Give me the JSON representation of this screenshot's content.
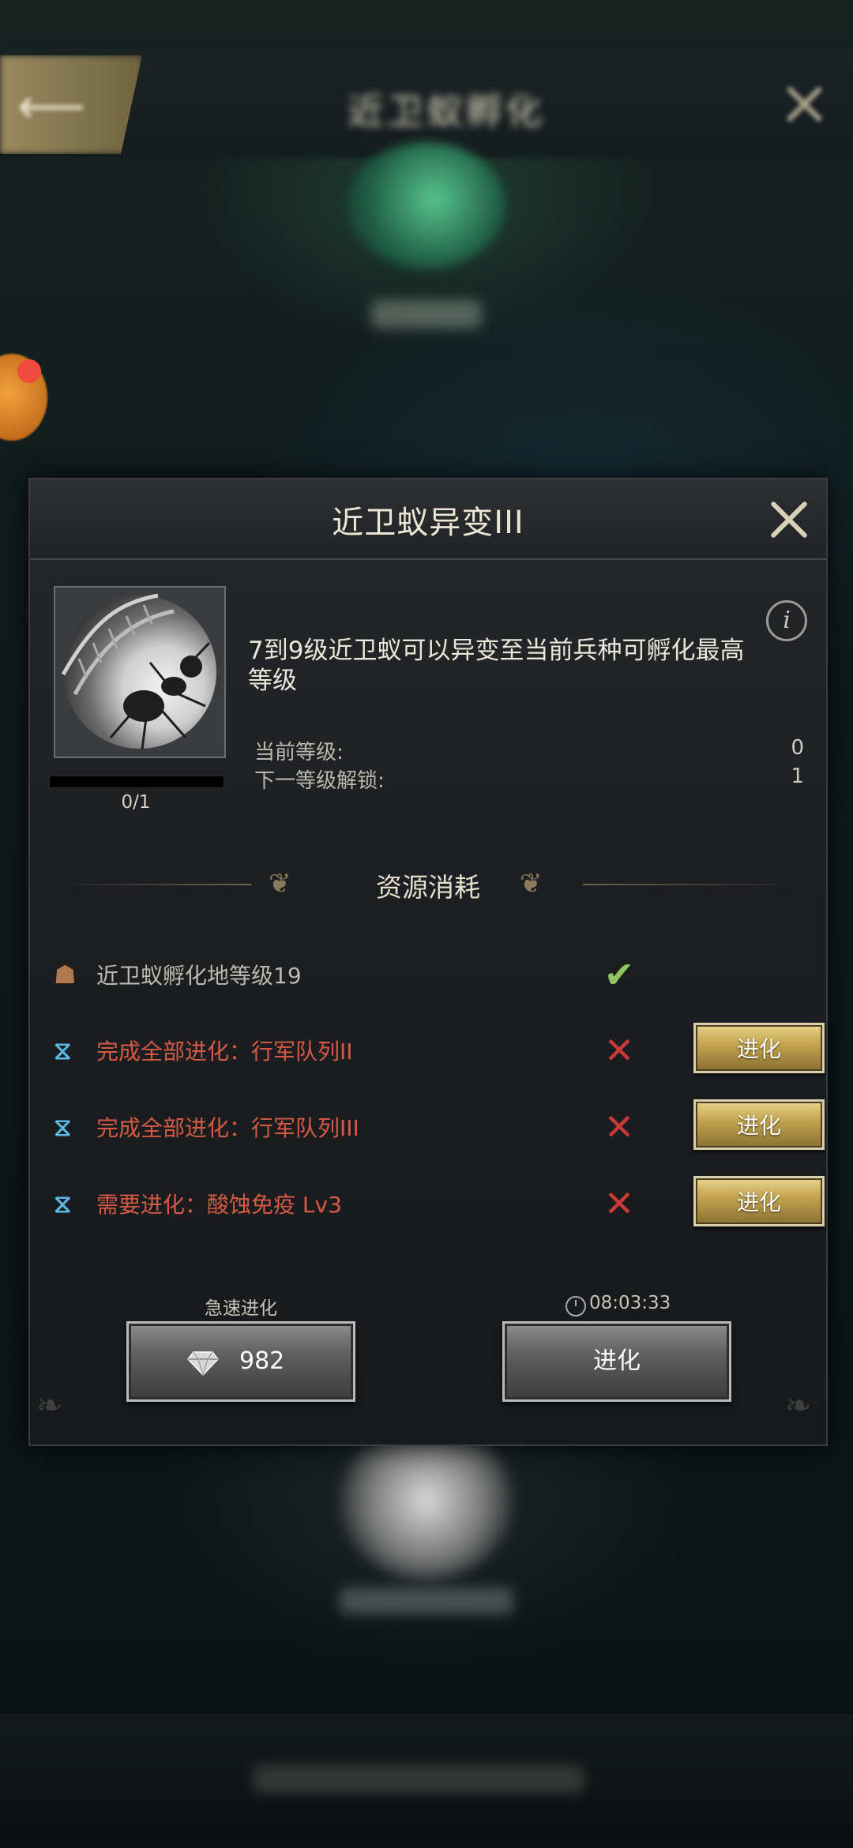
{
  "background": {
    "screen_title": "近卫蚁孵化"
  },
  "dialog": {
    "title": "近卫蚁异变III",
    "description": "7到9级近卫蚁可以异变至当前兵种可孵化最高等级",
    "progress_text": "0/1",
    "progress_fraction": 0,
    "current_level_label": "当前等级:",
    "current_level_value": "0",
    "next_unlock_label": "下一等级解锁:",
    "next_unlock_value": "1",
    "section_title": "资源消耗",
    "requirements": [
      {
        "icon": "nest-icon",
        "text": "近卫蚁孵化地等级19",
        "met": true,
        "status_glyph": "✔",
        "button": ""
      },
      {
        "icon": "dna-icon",
        "text": "完成全部进化：行军队列II",
        "met": false,
        "status_glyph": "✕",
        "button": "进化"
      },
      {
        "icon": "dna-icon",
        "text": "完成全部进化：行军队列III",
        "met": false,
        "status_glyph": "✕",
        "button": "进化"
      },
      {
        "icon": "dna-icon",
        "text": "需要进化：酸蚀免疫 Lv3",
        "met": false,
        "status_glyph": "✕",
        "button": "进化"
      }
    ],
    "instant_caption": "急速进化",
    "instant_cost": "982",
    "timer": "08:03:33",
    "evolve_label": "进化"
  },
  "colors": {
    "met_text": "#bdb9ae",
    "unmet_text": "#d55a45",
    "check": "#8fc55f",
    "cross": "#c93a36",
    "gold_button": "#c4a54f"
  }
}
